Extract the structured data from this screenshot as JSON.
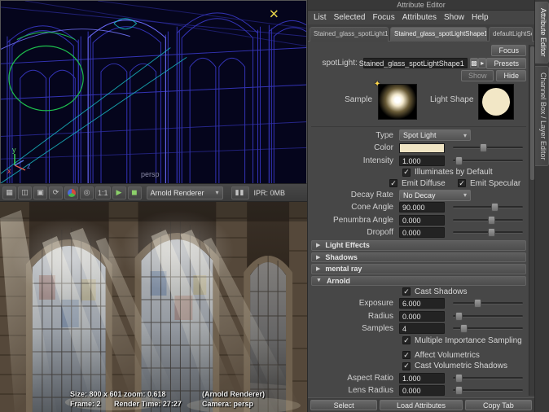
{
  "viewport": {
    "camera_label": "persp",
    "axis_y": "y",
    "axis_x": "x",
    "axis_z": "z"
  },
  "render_view": {
    "toolbar": {
      "icons": [
        {
          "name": "render-scene-icon",
          "glyph": "▦"
        },
        {
          "name": "snapshot-icon",
          "glyph": "◫"
        },
        {
          "name": "render-region-icon",
          "glyph": "▣"
        },
        {
          "name": "refresh-render-icon",
          "glyph": "⟳"
        },
        {
          "name": "rgb-channels-icon",
          "glyph": ""
        },
        {
          "name": "alpha-channel-icon",
          "glyph": "◎"
        },
        {
          "name": "ratio-one-to-one",
          "glyph": "1:1"
        },
        {
          "name": "ipr-render-icon",
          "glyph": "▶"
        },
        {
          "name": "ipr-region-icon",
          "glyph": "◼"
        }
      ],
      "renderer": "Arnold Renderer",
      "pause": "▮▮",
      "ipr_status": "IPR: 0MB"
    },
    "status_line1": {
      "size": "Size: 800 x 601 zoom: 0.618",
      "renderer_note": "(Arnold Renderer)"
    },
    "status_line2": {
      "frame": "Frame: 2",
      "render_time": "Render Time: 27:27",
      "camera": "Camera: persp"
    }
  },
  "attribute_editor": {
    "title": "Attribute Editor",
    "menus": [
      "List",
      "Selected",
      "Focus",
      "Attributes",
      "Show",
      "Help"
    ],
    "tabs": [
      {
        "label": "Stained_glass_spotLight1"
      },
      {
        "label": "Stained_glass_spotLightShape1"
      },
      {
        "label": "defaultLightSet"
      }
    ],
    "spotlight": {
      "label": "spotLight:",
      "value": "Stained_glass_spotLightShape1"
    },
    "buttons": {
      "focus": "Focus",
      "presets": "Presets",
      "show": "Show",
      "hide": "Hide"
    },
    "swatches": {
      "sample_label": "Sample",
      "light_shape_label": "Light Shape"
    },
    "fields": {
      "type": {
        "label": "Type",
        "value": "Spot Light"
      },
      "color": {
        "label": "Color"
      },
      "intensity": {
        "label": "Intensity",
        "value": "1.000"
      },
      "illuminates": {
        "label": "Illuminates by Default"
      },
      "emit_diffuse": {
        "label": "Emit Diffuse"
      },
      "emit_specular": {
        "label": "Emit Specular"
      },
      "decay_rate": {
        "label": "Decay Rate",
        "value": "No Decay"
      },
      "cone_angle": {
        "label": "Cone Angle",
        "value": "90.000"
      },
      "penumbra_angle": {
        "label": "Penumbra Angle",
        "value": "0.000"
      },
      "dropoff": {
        "label": "Dropoff",
        "value": "0.000"
      }
    },
    "sections": {
      "light_effects": "Light Effects",
      "shadows": "Shadows",
      "mental_ray": "mental ray",
      "arnold": "Arnold"
    },
    "arnold": {
      "cast_shadows": {
        "label": "Cast Shadows"
      },
      "exposure": {
        "label": "Exposure",
        "value": "6.000"
      },
      "radius": {
        "label": "Radius",
        "value": "0.000"
      },
      "samples": {
        "label": "Samples",
        "value": "4"
      },
      "mis": {
        "label": "Multiple Importance Sampling"
      },
      "affect_volumetrics": {
        "label": "Affect Volumetrics"
      },
      "cast_volumetric_shadows": {
        "label": "Cast Volumetric Shadows"
      },
      "aspect_ratio": {
        "label": "Aspect Ratio",
        "value": "1.000"
      },
      "lens_radius": {
        "label": "Lens Radius",
        "value": "0.000"
      }
    },
    "footer_buttons": {
      "select": "Select",
      "load_attributes": "Load Attributes",
      "copy_tab": "Copy Tab"
    }
  },
  "side_tabs": {
    "attribute_editor": "Attribute Editor",
    "channel_box": "Channel Box / Layer Editor"
  },
  "colors": {
    "light_color": "#f0e5c4",
    "wireframe_blue": "#3c3cd0",
    "manipulator_green": "#1ec04e"
  }
}
